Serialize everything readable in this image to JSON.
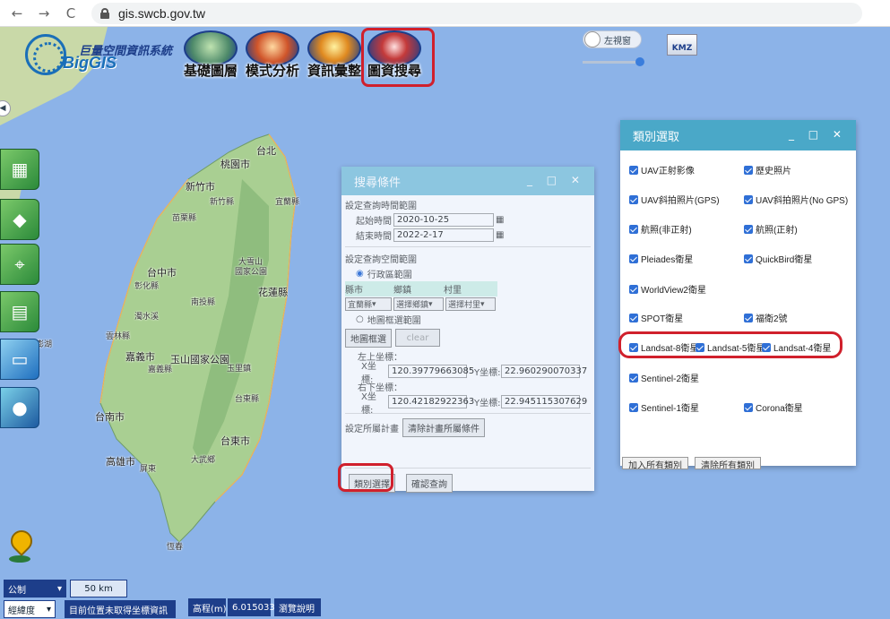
{
  "browser": {
    "url": "gis.swcb.gov.tw",
    "back": "←",
    "forward": "→",
    "reload": "C"
  },
  "logo": {
    "system_name": "巨量空間資訊系統",
    "brand": "BigGIS"
  },
  "toolbar": [
    {
      "label": "基礎圖層",
      "icon": "layers-icon"
    },
    {
      "label": "模式分析",
      "icon": "compass-icon"
    },
    {
      "label": "資訊彙整",
      "icon": "info-summary-icon"
    },
    {
      "label": "圖資搜尋",
      "icon": "map-search-icon"
    }
  ],
  "left_view": {
    "label": "左視窗"
  },
  "kmz": {
    "label": "KMZ"
  },
  "cities": [
    {
      "name": "台北"
    },
    {
      "name": "桃園市"
    },
    {
      "name": "新竹市"
    },
    {
      "name": "新竹縣"
    },
    {
      "name": "苗栗縣"
    },
    {
      "name": "宜蘭縣"
    },
    {
      "name": "台中市"
    },
    {
      "name": "大雪山"
    },
    {
      "name": "國家公園"
    },
    {
      "name": "花蓮縣"
    },
    {
      "name": "彰化縣"
    },
    {
      "name": "南投縣"
    },
    {
      "name": "濁水溪"
    },
    {
      "name": "雲林縣"
    },
    {
      "name": "嘉義市"
    },
    {
      "name": "嘉義縣"
    },
    {
      "name": "玉山國家公園"
    },
    {
      "name": "玉里鎮"
    },
    {
      "name": "台南市"
    },
    {
      "name": "高雄市"
    },
    {
      "name": "台東市"
    },
    {
      "name": "台東縣"
    },
    {
      "name": "大武鄉"
    },
    {
      "name": "屏東"
    },
    {
      "name": "恆春"
    },
    {
      "name": "澎湖"
    }
  ],
  "search_dialog": {
    "title": "搜尋條件",
    "time_section": "設定查詢時間範圍",
    "start_label": "起始時間",
    "start_value": "2020-10-25",
    "end_label": "結束時間",
    "end_value": "2022-2-17",
    "space_section": "設定查詢空間範圍",
    "admin_radio": "行政區範圍",
    "col_county": "縣市",
    "col_town": "鄉鎮",
    "col_village": "村里",
    "county_value": "宜蘭縣",
    "town_value": "選擇鄉鎮",
    "village_value": "選擇村里",
    "map_radio": "地圖框選範圍",
    "map_frame_btn": "地圖框選",
    "clear_btn": "clear",
    "upper_left": "左上坐標：",
    "x_label": "X坐標:",
    "y_label": "Y坐標:",
    "ul_x": "120.39779663085",
    "ul_y": "22.960290070337",
    "lower_right": "右下坐標：",
    "lr_x": "120.42182922363",
    "lr_y": "22.945115307629",
    "project_section": "設定所屬計畫",
    "clear_projects_btn": "清除計畫所屬條件",
    "category_btn": "類別選擇",
    "confirm_btn": "確認查詢"
  },
  "category_dialog": {
    "title": "類別選取",
    "items": [
      {
        "label": "UAV正射影像",
        "checked": true
      },
      {
        "label": "歷史照片",
        "checked": true
      },
      {
        "label": "UAV斜拍照片(GPS)",
        "checked": true
      },
      {
        "label": "UAV斜拍照片(No GPS)",
        "checked": true
      },
      {
        "label": "航照(非正射)",
        "checked": true
      },
      {
        "label": "航照(正射)",
        "checked": true
      },
      {
        "label": "Pleiades衛星",
        "checked": true
      },
      {
        "label": "QuickBird衛星",
        "checked": true
      },
      {
        "label": "WorldView2衛星",
        "checked": true
      },
      {
        "label": "SPOT衛星",
        "checked": true
      },
      {
        "label": "福衛2號",
        "checked": true
      },
      {
        "label": "Landsat-8衛星",
        "checked": true
      },
      {
        "label": "Landsat-5衛星",
        "checked": true
      },
      {
        "label": "Landsat-4衛星",
        "checked": true
      },
      {
        "label": "Sentinel-2衛星",
        "checked": true
      },
      {
        "label": "Sentinel-1衛星",
        "checked": true
      },
      {
        "label": "Corona衛星",
        "checked": true
      }
    ],
    "add_all_btn": "加入所有類別",
    "clear_all_btn": "清除所有類別"
  },
  "bottom": {
    "unit": "公制",
    "scale": "50 km",
    "coord_system": "經緯度",
    "position_status": "目前位置未取得坐標資訊",
    "elevation_label": "高程(m)",
    "elevation_value": "6.015033",
    "help_btn": "瀏覽說明"
  },
  "colors": {
    "highlight": "#d0202c",
    "dialog_title": "#4aa8c8",
    "checkbox": "#2f6fd6",
    "sea": "#8cb3e8",
    "land": "#a9cf92"
  }
}
